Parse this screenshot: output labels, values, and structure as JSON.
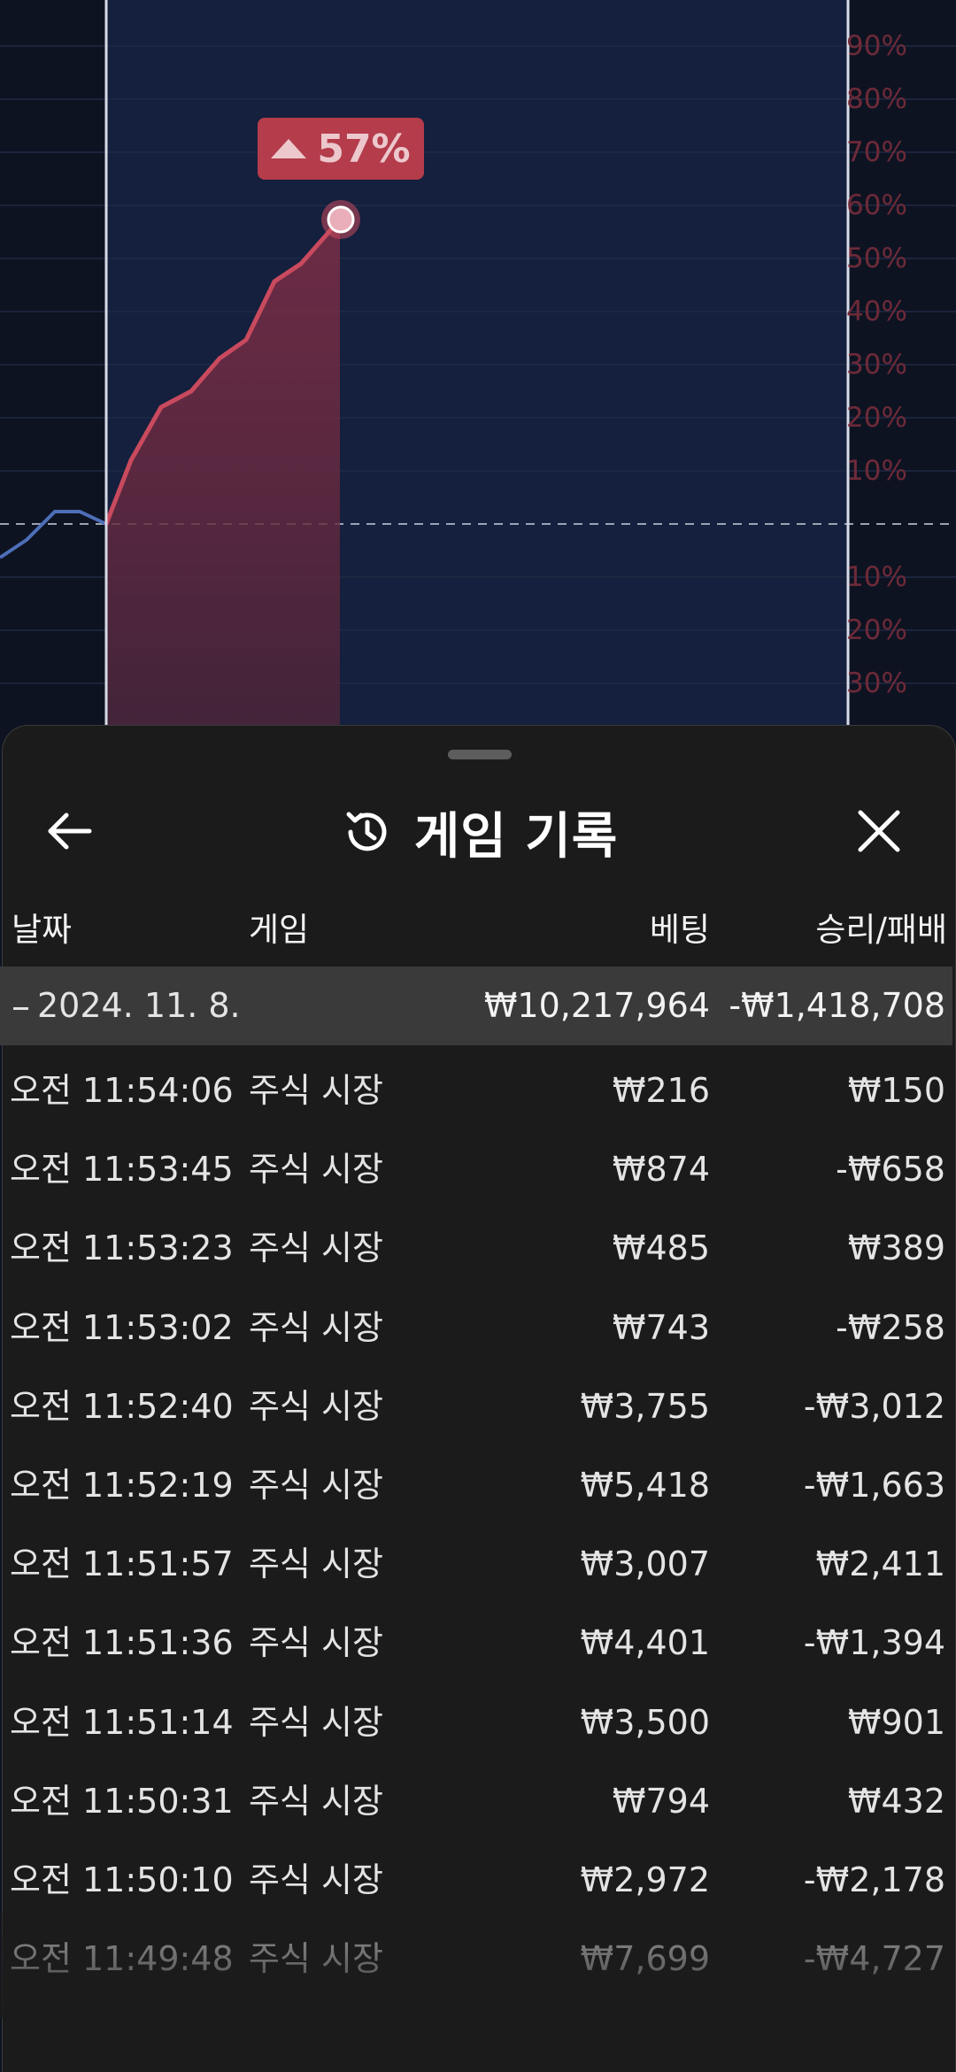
{
  "chart": {
    "change_badge": "57%",
    "percent_labels": [
      "90%",
      "80%",
      "70%",
      "60%",
      "50%",
      "40%",
      "30%",
      "20%",
      "10%",
      "10%",
      "20%",
      "30%"
    ]
  },
  "sheet": {
    "title": "게임 기록",
    "columns": {
      "date": "날짜",
      "game": "게임",
      "bet": "베팅",
      "result": "승리/패배"
    },
    "summary": {
      "toggle": "–",
      "date": "2024. 11. 8.",
      "bet_total": "₩10,217,964",
      "result_total": "-₩1,418,708"
    },
    "rows": [
      {
        "time": "오전 11:54:06",
        "game": "주식 시장",
        "bet": "₩216",
        "result": "₩150"
      },
      {
        "time": "오전 11:53:45",
        "game": "주식 시장",
        "bet": "₩874",
        "result": "-₩658"
      },
      {
        "time": "오전 11:53:23",
        "game": "주식 시장",
        "bet": "₩485",
        "result": "₩389"
      },
      {
        "time": "오전 11:53:02",
        "game": "주식 시장",
        "bet": "₩743",
        "result": "-₩258"
      },
      {
        "time": "오전 11:52:40",
        "game": "주식 시장",
        "bet": "₩3,755",
        "result": "-₩3,012"
      },
      {
        "time": "오전 11:52:19",
        "game": "주식 시장",
        "bet": "₩5,418",
        "result": "-₩1,663"
      },
      {
        "time": "오전 11:51:57",
        "game": "주식 시장",
        "bet": "₩3,007",
        "result": "₩2,411"
      },
      {
        "time": "오전 11:51:36",
        "game": "주식 시장",
        "bet": "₩4,401",
        "result": "-₩1,394"
      },
      {
        "time": "오전 11:51:14",
        "game": "주식 시장",
        "bet": "₩3,500",
        "result": "₩901"
      },
      {
        "time": "오전 11:50:31",
        "game": "주식 시장",
        "bet": "₩794",
        "result": "₩432"
      },
      {
        "time": "오전 11:50:10",
        "game": "주식 시장",
        "bet": "₩2,972",
        "result": "-₩2,178"
      },
      {
        "time": "오전 11:49:48",
        "game": "주식 시장",
        "bet": "₩7,699",
        "result": "-₩4,727"
      }
    ]
  },
  "colors": {
    "sheet_bg": "#1b1b1b",
    "chart_bg": "#0e1322",
    "accent_red": "#b43c4b",
    "summary_bg": "#3a3a3a"
  },
  "icons": {
    "back": "arrow-left-icon",
    "history": "history-clock-icon",
    "close": "close-icon"
  }
}
